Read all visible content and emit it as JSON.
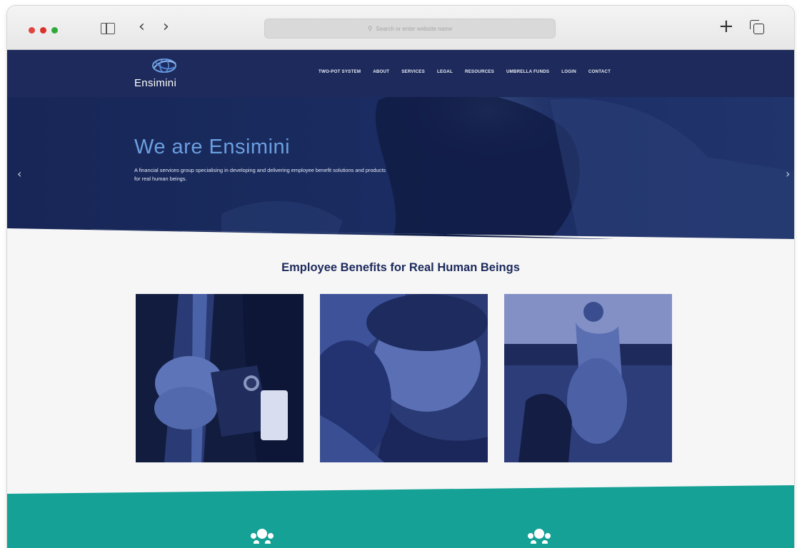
{
  "browser": {
    "address_placeholder": "Search or enter website name",
    "icons": [
      "sidebar-icon",
      "back-chevron-icon",
      "forward-chevron-icon",
      "search-icon",
      "new-tab-plus-icon",
      "tabs-overview-icon"
    ]
  },
  "site": {
    "logo_text": "Ensimini",
    "nav": [
      "TWO-POT SYSTEM",
      "ABOUT",
      "SERVICES",
      "LEGAL",
      "RESOURCES",
      "UMBRELLA FUNDS",
      "LOGIN",
      "CONTACT"
    ]
  },
  "hero": {
    "title": "We are Ensimini",
    "subtitle": "A financial services group specialising in developing and delivering employee benefit solutions and products for real human beings.",
    "prev_arrow": "‹",
    "next_arrow": "›"
  },
  "benefits": {
    "title": "Employee Benefits for Real Human Beings",
    "cards": [
      {
        "alt": "businessman-hands-photo"
      },
      {
        "alt": "couple-embrace-photo"
      },
      {
        "alt": "parent-carrying-child-photo"
      }
    ]
  },
  "colors": {
    "navy": "#1d2a5b",
    "hero_title": "#6b9fe0",
    "teal": "#15a196",
    "heading": "#1c2a5c"
  }
}
